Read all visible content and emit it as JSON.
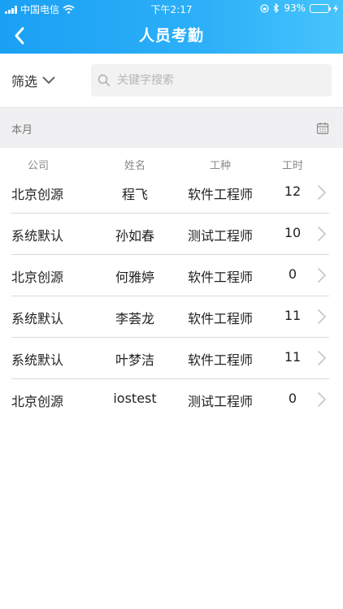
{
  "status_bar": {
    "carrier": "中国电信",
    "time": "下午2:17",
    "battery": "93%",
    "battery_level": 0.93
  },
  "navbar": {
    "title": "人员考勤",
    "back_icon": "chevron-left-icon"
  },
  "filter": {
    "label": "筛选",
    "search_placeholder": "关键字搜索",
    "search_value": ""
  },
  "period": {
    "label": "本月",
    "calendar_icon": "calendar-icon"
  },
  "table": {
    "headers": [
      "公司",
      "姓名",
      "工种",
      "工时"
    ],
    "rows": [
      {
        "company": "北京创源",
        "name": "程飞",
        "trade": "软件工程师",
        "hours": "12"
      },
      {
        "company": "系统默认",
        "name": "孙如春",
        "trade": "测试工程师",
        "hours": "10"
      },
      {
        "company": "北京创源",
        "name": "何雅婷",
        "trade": "软件工程师",
        "hours": "0"
      },
      {
        "company": "系统默认",
        "name": "李荟龙",
        "trade": "软件工程师",
        "hours": "11"
      },
      {
        "company": "系统默认",
        "name": "叶梦洁",
        "trade": "软件工程师",
        "hours": "11"
      },
      {
        "company": "北京创源",
        "name": "iostest",
        "trade": "测试工程师",
        "hours": "0"
      }
    ]
  },
  "colors": {
    "header_start": "#1aa0f4",
    "header_end": "#46c4fb",
    "battery_fill": "#4cd964"
  }
}
